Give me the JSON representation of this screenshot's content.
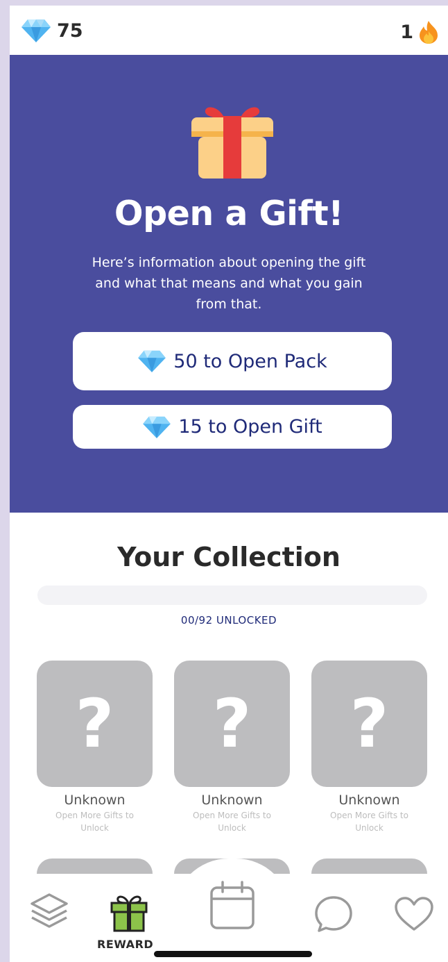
{
  "topbar": {
    "gem_count": "75",
    "streak_count": "1",
    "gem_icon": "diamond-icon",
    "streak_icon": "fire-icon"
  },
  "hero": {
    "icon": "gift-icon",
    "title": "Open a Gift!",
    "description": "Here’s information about opening the gift and what that means and what you gain from that.",
    "pack_button_label": "50 to Open Pack",
    "gift_button_label": "15 to Open Gift",
    "background_color": "#4a4d9e"
  },
  "collection": {
    "title": "Your Collection",
    "progress_fraction": 0,
    "unlocked_label": "00/92 UNLOCKED",
    "cards": [
      {
        "symbol": "?",
        "name": "Unknown",
        "hint": "Open More Gifts to Unlock"
      },
      {
        "symbol": "?",
        "name": "Unknown",
        "hint": "Open More Gifts to Unlock"
      },
      {
        "symbol": "?",
        "name": "Unknown",
        "hint": "Open More Gifts to Unlock"
      }
    ]
  },
  "nav": {
    "items": [
      {
        "icon": "layers-icon"
      },
      {
        "icon": "gift-icon",
        "label": "REWARD",
        "active": true
      },
      {
        "icon": "calendar-icon"
      },
      {
        "icon": "chat-bubble-icon"
      },
      {
        "icon": "heart-icon"
      }
    ]
  },
  "colors": {
    "accent": "#4a4d9e",
    "text_dark": "#1f2a78",
    "reward_green": "#8cc34a"
  }
}
